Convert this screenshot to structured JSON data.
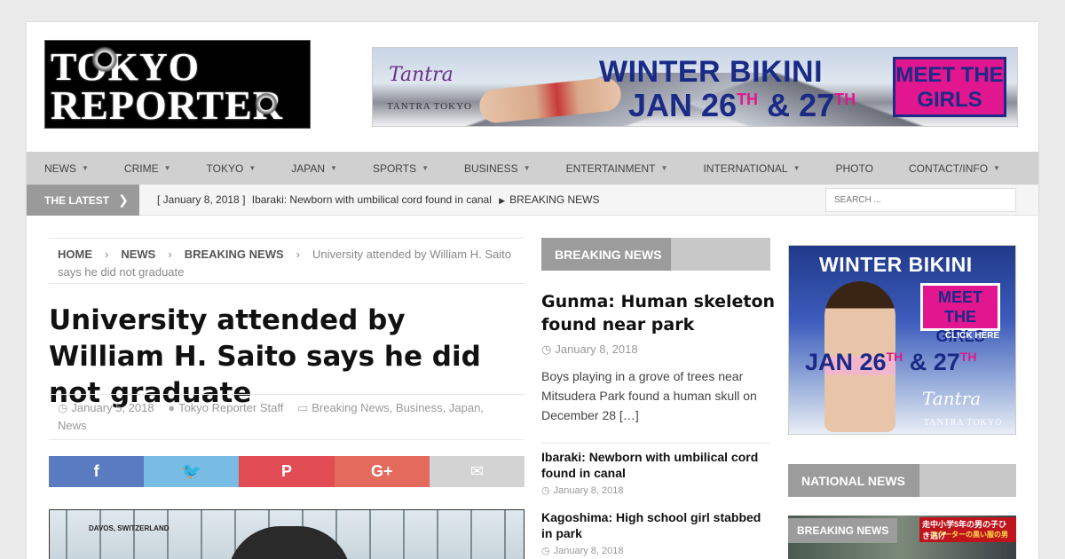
{
  "header": {
    "logo_line1": "TOKYO",
    "logo_line2": "REPORTER",
    "top_ad": {
      "brand": "Tantra",
      "brand_sub": "TANTRA TOKYO",
      "headline1": "WINTER BIKINI",
      "headline2_a": "JAN 26",
      "headline2_b": "TH",
      "headline2_c": " & 27",
      "headline2_d": "TH",
      "cta": "MEET THE GIRLS"
    }
  },
  "nav": {
    "items": [
      {
        "label": "NEWS",
        "caret": true
      },
      {
        "label": "CRIME",
        "caret": true
      },
      {
        "label": "TOKYO",
        "caret": true
      },
      {
        "label": "JAPAN",
        "caret": true
      },
      {
        "label": "SPORTS",
        "caret": true
      },
      {
        "label": "BUSINESS",
        "caret": true
      },
      {
        "label": "ENTERTAINMENT",
        "caret": true
      },
      {
        "label": "INTERNATIONAL",
        "caret": true
      },
      {
        "label": "PHOTO",
        "caret": false
      },
      {
        "label": "CONTACT/INFO",
        "caret": true
      }
    ]
  },
  "ticker": {
    "label": "THE LATEST",
    "date": "[ January 8, 2018 ]",
    "headline": "Ibaraki: Newborn with umbilical cord found in canal",
    "category": "BREAKING NEWS",
    "search_placeholder": "SEARCH ..."
  },
  "breadcrumb": {
    "home": "HOME",
    "news": "NEWS",
    "breaking": "BREAKING NEWS",
    "current": "University attended by William H. Saito says he did not graduate"
  },
  "article": {
    "title": "University attended by William H. Saito says he did not graduate",
    "date": "January 5, 2018",
    "author": "Tokyo Reporter Staff",
    "categories": "Breaking News, Business, Japan, News",
    "photo_caption": "DAVOS, SWITZERLAND"
  },
  "share": {
    "icons": [
      "facebook-icon",
      "twitter-icon",
      "pinterest-icon",
      "google-plus-icon",
      "email-icon"
    ],
    "colors": [
      "#5b7bc0",
      "#78bbe3",
      "#e14c55",
      "#e36a5c",
      "#d3d3d3"
    ],
    "glyphs": [
      "f",
      "🐦",
      "P",
      "G+",
      "✉"
    ]
  },
  "middle": {
    "section_title": "BREAKING NEWS",
    "lead_title": "Gunma: Human skeleton found near park",
    "lead_date": "January 8, 2018",
    "lead_excerpt": "Boys playing in a grove of trees near Mitsudera Park found a human skull on December 28 […]",
    "items": [
      {
        "title": "Ibaraki: Newborn with umbilical cord found in canal",
        "date": "January 8, 2018"
      },
      {
        "title": "Kagoshima: High school girl stabbed in park",
        "date": "January 8, 2018"
      }
    ]
  },
  "right": {
    "ad": {
      "headline": "WINTER BIKINI",
      "cta": "MEET THE GIRLS",
      "click": "CLICK HERE",
      "jan_a": "JAN 26",
      "jan_b": "TH",
      "jan_c": " & 27",
      "jan_d": "TH",
      "brand": "Tantra",
      "brand_sub": "TANTRA TOKYO"
    },
    "national_title": "NATIONAL NEWS",
    "thumb_label": "BREAKING NEWS",
    "thumb_jp1": "走中小学5年の男の子ひき逃げ",
    "thumb_jp2": "スクーターの黒い服の男"
  }
}
